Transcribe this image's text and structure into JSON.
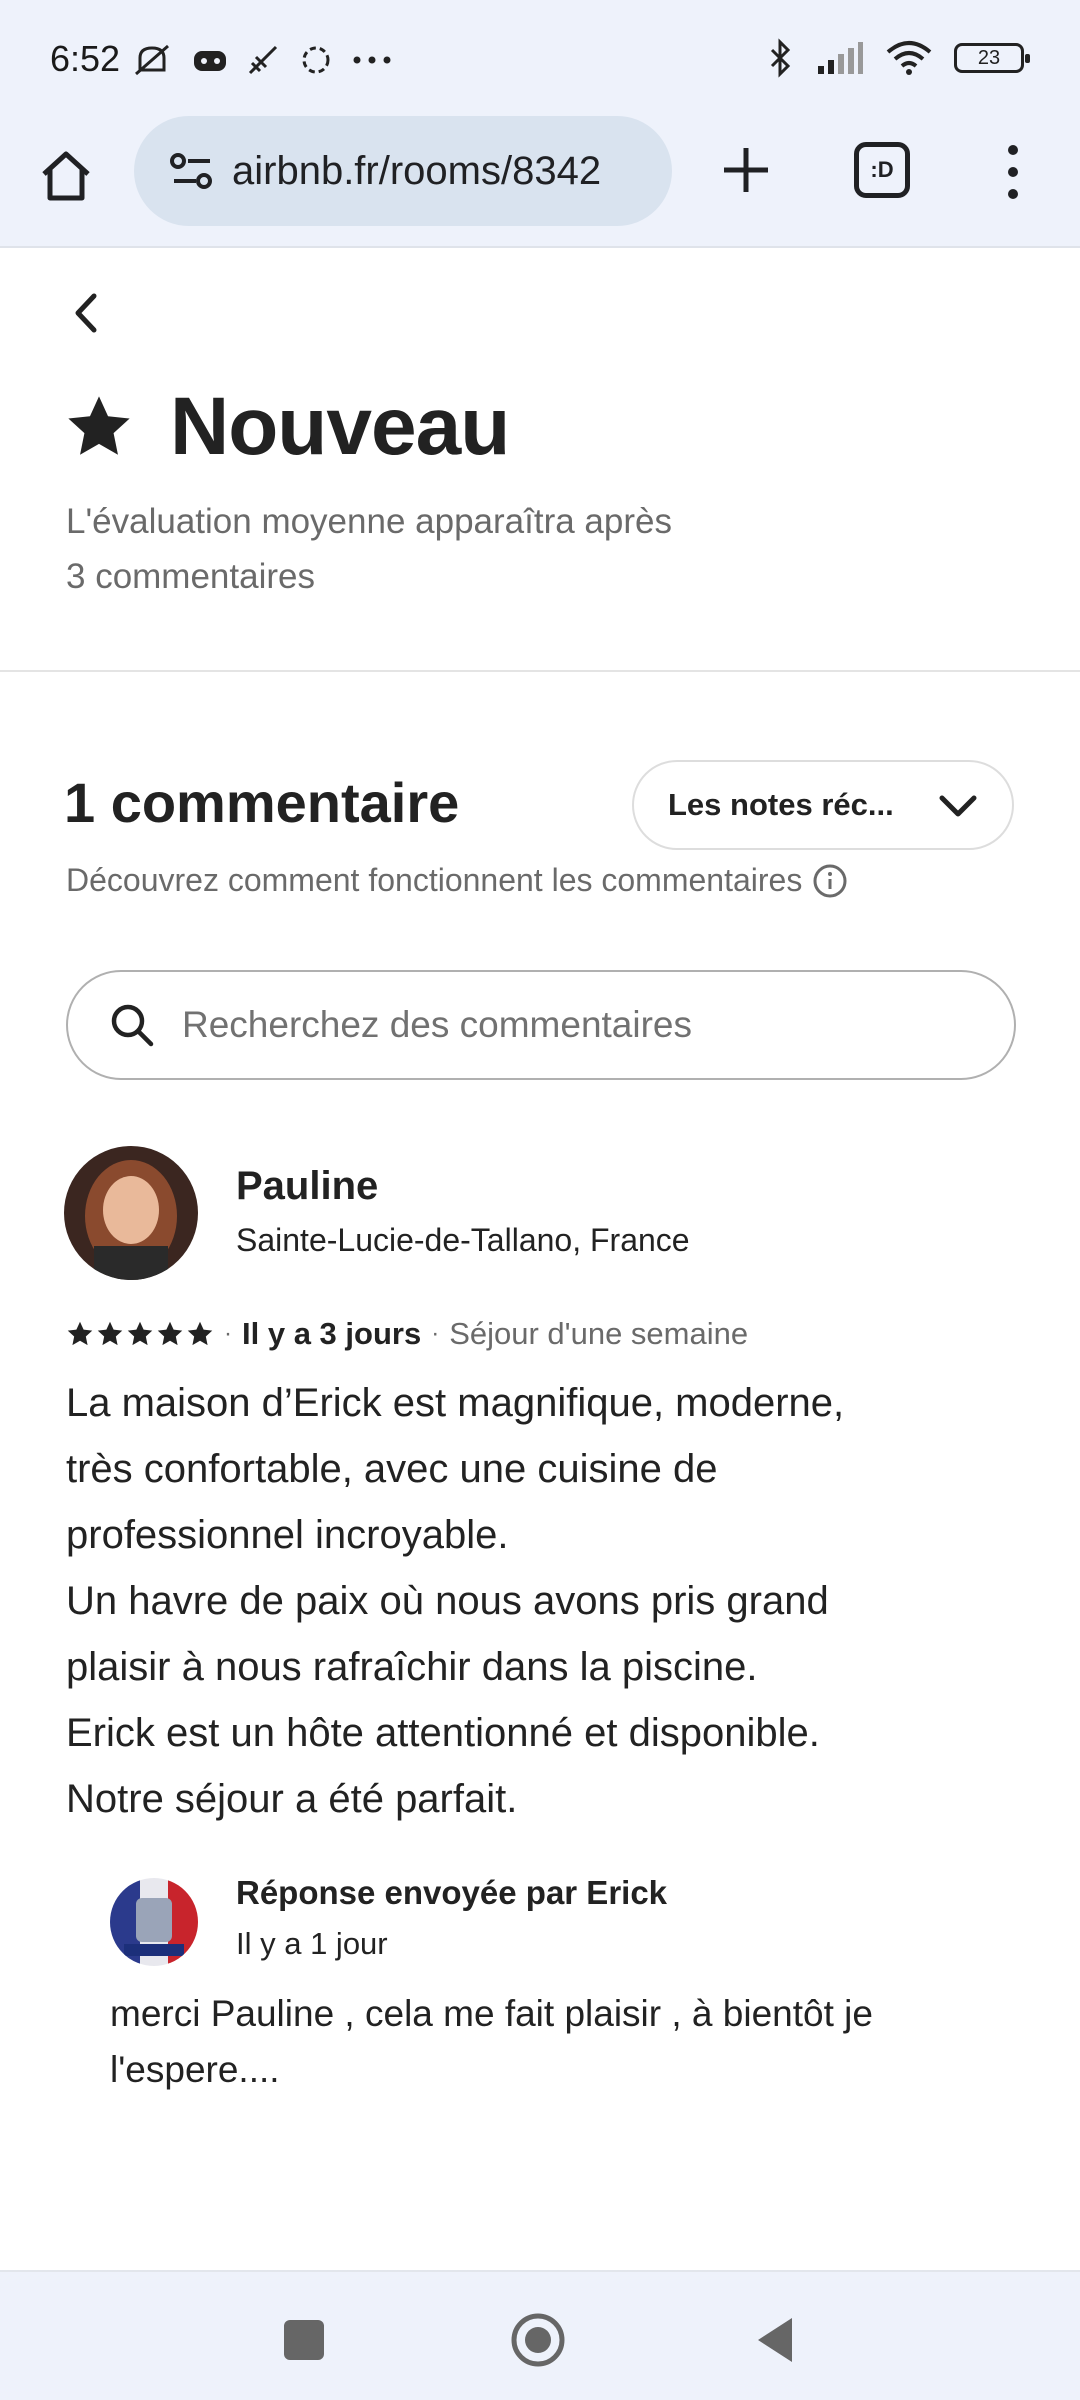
{
  "status_bar": {
    "time": "6:52",
    "battery": "23"
  },
  "browser": {
    "url": "airbnb.fr/rooms/8342",
    "tab_count": ":D"
  },
  "rating": {
    "title": "Nouveau",
    "subtitle_line1": "L'évaluation moyenne apparaîtra après",
    "subtitle_line2": "3 commentaires"
  },
  "comments": {
    "count_label": "1 commentaire",
    "sort_label": "Les notes réc...",
    "how_it_works": "Découvrez comment fonctionnent les commentaires",
    "search_placeholder": "Recherchez des commentaires"
  },
  "review": {
    "name": "Pauline",
    "location": "Sainte-Lucie-de-Tallano, France",
    "stars": 5,
    "date": "Il y a 3 jours",
    "stay": "Séjour d'une semaine",
    "lines": [
      "La maison d’Erick est magnifique, moderne,",
      "très confortable, avec une cuisine de",
      "professionnel incroyable.",
      "Un havre de paix où nous avons pris grand",
      "plaisir à nous rafraîchir dans la piscine.",
      "Erick est un hôte attentionné et disponible.",
      "Notre séjour a été parfait."
    ]
  },
  "host_response": {
    "title": "Réponse envoyée par Erick",
    "date": "Il y a 1 jour",
    "line1": "merci Pauline , cela me fait plaisir , à bientôt je",
    "line2": "l'espere...."
  },
  "colors": {
    "chrome_bg": "#eef2fb",
    "url_bg": "#d9e3ef",
    "text_primary": "#222222",
    "text_secondary": "#6a6a6a"
  }
}
